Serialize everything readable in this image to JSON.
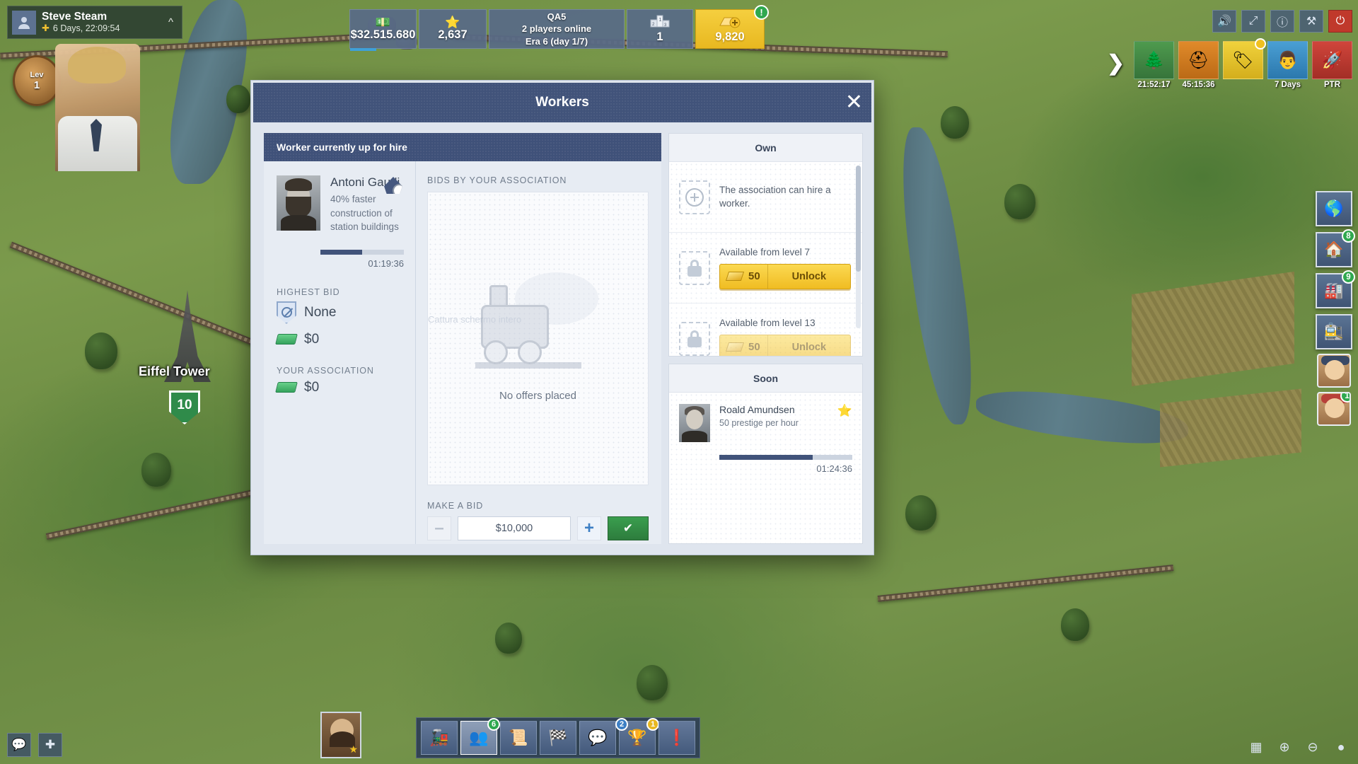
{
  "player": {
    "name": "Steve Steam",
    "plus_icon": "plus-badge-icon",
    "time_remaining": "6 Days, 22:09:54",
    "collapse_icon": "chevron-up-icon",
    "avatar_icon": "person-icon",
    "level_label": "Lev",
    "level_value": "1"
  },
  "map": {
    "city_name": "Eiffel Tower",
    "city_level": "10"
  },
  "status_bar": {
    "money": {
      "value": "$32.515.680",
      "icon": "money-stack-icon"
    },
    "prestige": {
      "value": "2,637",
      "icon": "star-icon"
    },
    "server": {
      "name": "QA5",
      "players_online": "2 players online",
      "era": "Era 6 (day 1/7)"
    },
    "rank": {
      "value": "1",
      "icon": "podium-icon"
    },
    "gold": {
      "value": "9,820",
      "icon": "gold-bar-plus-icon",
      "alert": "!"
    }
  },
  "top_right_icons": [
    {
      "name": "sound-icon",
      "glyph": "ὐA"
    },
    {
      "name": "fullscreen-icon",
      "glyph": "⤢"
    },
    {
      "name": "help-icon",
      "glyph": "?"
    },
    {
      "name": "settings-icon",
      "glyph": "⚒"
    },
    {
      "name": "power-icon",
      "glyph": "⏻"
    }
  ],
  "shortcuts": [
    {
      "name": "tree-tile",
      "icon": "tree-icon",
      "caption": "21:52:17",
      "color": "green"
    },
    {
      "name": "helmet-tile",
      "icon": "hard-hat-icon",
      "caption": "45:15:36",
      "color": "orange"
    },
    {
      "name": "ticket-tile",
      "icon": "ticket-icon",
      "caption": "",
      "color": "yellow",
      "badge": true
    },
    {
      "name": "investor-tile",
      "icon": "investor-icon",
      "caption": "7 Days",
      "color": "blue"
    },
    {
      "name": "ptr-tile",
      "icon": "rocket-icon",
      "caption": "PTR",
      "color": "red"
    }
  ],
  "collapse_arrow": "❯",
  "right_rail": [
    {
      "name": "world-map-button",
      "icon": "globe-icon",
      "badge": ""
    },
    {
      "name": "city-button",
      "icon": "house-icon",
      "badge": "8"
    },
    {
      "name": "industry-button",
      "icon": "factory-icon",
      "badge": "9"
    },
    {
      "name": "add-station-button",
      "icon": "station-plus-icon",
      "badge": ""
    }
  ],
  "right_avatars": [
    {
      "name": "advisor-avatar-1",
      "badge": ""
    },
    {
      "name": "advisor-avatar-2",
      "badge": "1"
    }
  ],
  "bottom_left": [
    {
      "name": "chat-button",
      "icon": "speech-bubble-icon"
    },
    {
      "name": "add-button",
      "icon": "plus-icon"
    }
  ],
  "bottom_nav": [
    {
      "name": "trains-button",
      "icon": "locomotive-icon",
      "badge": "",
      "active": false
    },
    {
      "name": "workers-button",
      "icon": "workers-icon",
      "badge": "6",
      "badge_color": "green",
      "active": true
    },
    {
      "name": "research-button",
      "icon": "research-icon",
      "badge": "",
      "active": false
    },
    {
      "name": "competition-button",
      "icon": "checkered-flag-icon",
      "badge": "",
      "active": false
    },
    {
      "name": "chat-nav-button",
      "icon": "chat-icon",
      "badge": "",
      "active": false
    },
    {
      "name": "ranking-button",
      "icon": "trophy-icon",
      "badge": "2",
      "badge2": "1",
      "active": false
    },
    {
      "name": "news-button",
      "icon": "exclamation-icon",
      "badge": "",
      "active": false
    }
  ],
  "bottom_right": [
    {
      "name": "minimap-icon",
      "glyph": "▣"
    },
    {
      "name": "zoom-in-icon",
      "glyph": "⊕"
    },
    {
      "name": "zoom-out-icon",
      "glyph": "⊖"
    },
    {
      "name": "location-icon",
      "glyph": "⏺"
    }
  ],
  "modal": {
    "title": "Workers",
    "close_icon": "close-icon",
    "left_card": {
      "header": "Worker currently up for hire",
      "worker": {
        "name": "Antoni Gaudi",
        "bonus": "40% faster construction of station buildings",
        "type_icon": "engineer-helmet-icon",
        "progress_percent": 50,
        "timer": "01:19:36"
      },
      "highest_bid": {
        "label": "HIGHEST BID",
        "bidder": "None",
        "bidder_icon": "no-bidder-shield-icon",
        "amount": "$0",
        "amount_icon": "cash-icon"
      },
      "your_association": {
        "label": "YOUR ASSOCIATION",
        "amount": "$0",
        "amount_icon": "cash-icon"
      },
      "bids": {
        "title": "BIDS BY YOUR ASSOCIATION",
        "empty_message": "No offers placed",
        "empty_icon": "broken-train-icon",
        "watermark": "Cattura schermo intero"
      },
      "make_bid": {
        "label": "MAKE A BID",
        "minus_icon": "minus-icon",
        "value": "$10,000",
        "plus_icon": "plus-icon",
        "confirm_icon": "checkmark-icon"
      }
    },
    "own_panel": {
      "title": "Own",
      "rows": [
        {
          "slot_icon": "plus-slot-icon",
          "text": "The association can hire a worker.",
          "has_unlock": false
        },
        {
          "slot_icon": "lock-icon",
          "text": "Available from level 7",
          "has_unlock": true,
          "unlock_cost": "50",
          "unlock_label": "Unlock",
          "cost_icon": "gold-bar-icon"
        },
        {
          "slot_icon": "lock-icon",
          "text": "Available from level 13",
          "has_unlock": true,
          "unlock_cost": "50",
          "unlock_label": "Unlock",
          "cost_icon": "gold-bar-icon"
        }
      ]
    },
    "soon_panel": {
      "title": "Soon",
      "worker": {
        "name": "Roald Amundsen",
        "bonus": "50 prestige per hour",
        "type_icon": "prestige-star-icon",
        "progress_percent": 70,
        "timer": "01:24:36"
      }
    }
  }
}
